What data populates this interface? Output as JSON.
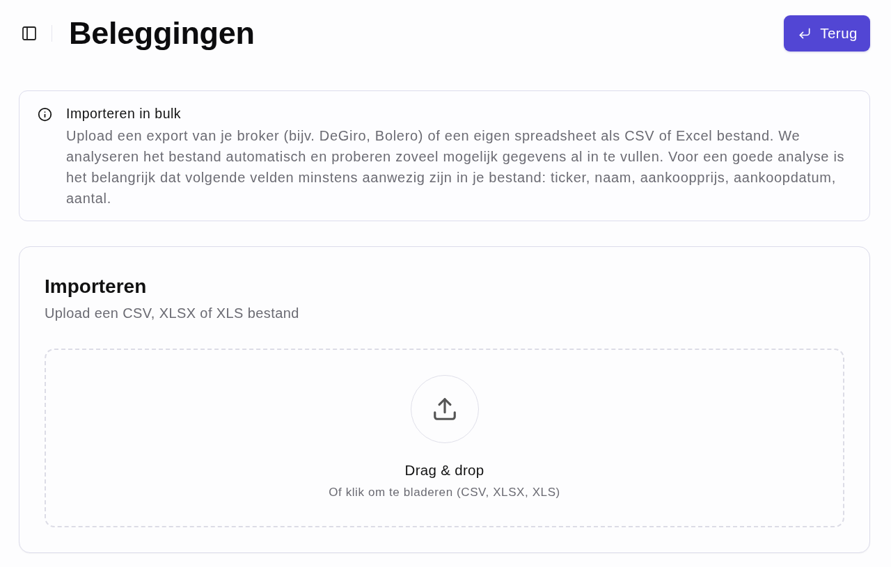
{
  "header": {
    "title": "Beleggingen",
    "back_button": {
      "label": "Terug"
    }
  },
  "notice": {
    "title": "Importeren in bulk",
    "body": "Upload een export van je broker (bijv. DeGiro, Bolero) of een eigen spreadsheet als CSV of Excel bestand. We analyseren het bestand automatisch en proberen zoveel mogelijk gegevens al in te vullen. Voor een goede analyse is het belangrijk dat volgende velden minstens aanwezig zijn in je bestand: ticker, naam, aankoopprijs, aankoopdatum, aantal."
  },
  "import_card": {
    "title": "Importeren",
    "subtitle": "Upload een CSV, XLSX of XLS bestand",
    "dropzone": {
      "title": "Drag & drop",
      "hint": "Of klik om te bladeren (CSV, XLSX, XLS)"
    }
  }
}
